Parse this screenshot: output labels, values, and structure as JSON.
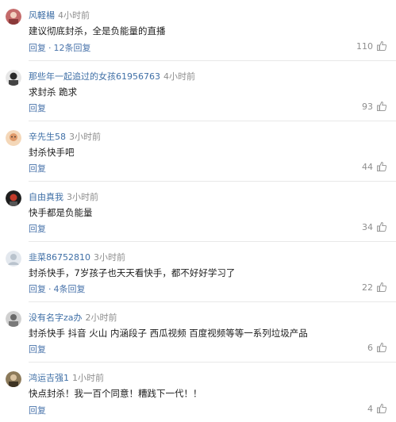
{
  "comments": [
    {
      "username": "风軽楊",
      "time": "4小时前",
      "text": "建议彻底封杀，全是负能量的直播",
      "reply_label": "回复",
      "sub_replies": "12条回复",
      "likes": "110",
      "avatar_color": "#c46a6a"
    },
    {
      "username": "那些年一起追过的女孩61956763",
      "time": "4小时前",
      "text": "求封杀 跪求",
      "reply_label": "回复",
      "sub_replies": "",
      "likes": "93",
      "avatar_color": "#3a3a3a"
    },
    {
      "username": "辛先生58",
      "time": "3小时前",
      "text": "封杀快手吧",
      "reply_label": "回复",
      "sub_replies": "",
      "likes": "44",
      "avatar_color": "#e09a6a"
    },
    {
      "username": "自由真我",
      "time": "3小时前",
      "text": "快手都是负能量",
      "reply_label": "回复",
      "sub_replies": "",
      "likes": "34",
      "avatar_color": "#2a2a2a"
    },
    {
      "username": "韭菜86752810",
      "time": "3小时前",
      "text": "封杀快手，7岁孩子也天天看快手，都不好好学习了",
      "reply_label": "回复",
      "sub_replies": "4条回复",
      "likes": "22",
      "avatar_color": "#cfd6dd"
    },
    {
      "username": "没有名字za办",
      "time": "2小时前",
      "text": "封杀快手 抖音 火山 内涵段子 西瓜视频 百度视频等等一系列垃圾产品",
      "reply_label": "回复",
      "sub_replies": "",
      "likes": "6",
      "avatar_color": "#8a8a8a"
    },
    {
      "username": "鸿运吉强1",
      "time": "1小时前",
      "text": "快点封杀！我一百个同意！糟践下一代！！",
      "reply_label": "回复",
      "sub_replies": "",
      "likes": "4",
      "avatar_color": "#6b5a3e"
    }
  ],
  "separator": "·"
}
